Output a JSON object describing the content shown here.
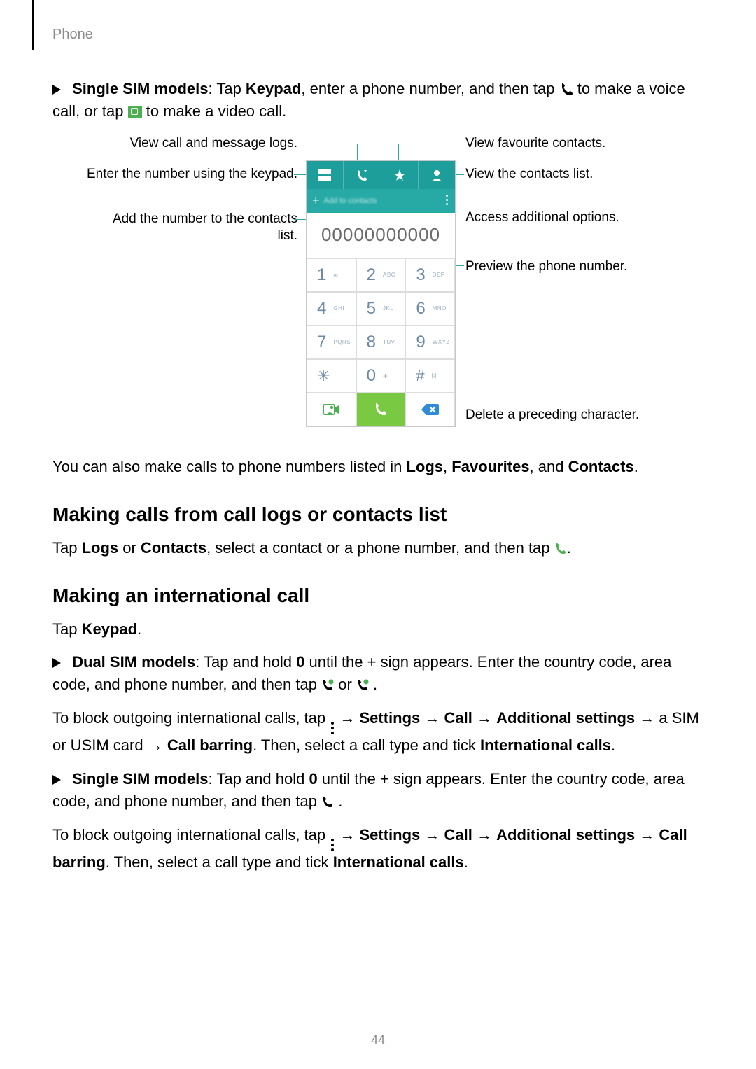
{
  "header": {
    "section": "Phone"
  },
  "intro": {
    "singleSimLead": "Single SIM models",
    "singleSimText1": ": Tap ",
    "keypad": "Keypad",
    "singleSimText2": ", enter a phone number, and then tap ",
    "singleSimText3": " to make a voice call, or tap ",
    "singleSimText4": " to make a video call."
  },
  "callouts": {
    "logs": "View call and message logs.",
    "keypad": "Enter the number using the keypad.",
    "addContact": "Add the number to the contacts list.",
    "favs": "View favourite contacts.",
    "contacts": "View the contacts list.",
    "options": "Access additional options.",
    "preview": "Preview the phone number.",
    "delete": "Delete a preceding character."
  },
  "mock": {
    "addToContacts": "Add to contacts",
    "numberPreview": "00000000000",
    "keys": {
      "k1": "1",
      "s1": "",
      "k2": "2",
      "s2": "ABC",
      "k3": "3",
      "s3": "DEF",
      "k4": "4",
      "s4": "GHI",
      "k5": "5",
      "s5": "JKL",
      "k6": "6",
      "s6": "MNO",
      "k7": "7",
      "s7": "PQRS",
      "k8": "8",
      "s8": "TUV",
      "k9": "9",
      "s9": "WXYZ",
      "star": "✳",
      "k0": "0",
      "s0": "+",
      "hash": "#"
    }
  },
  "afterDiagram": {
    "text1": "You can also make calls to phone numbers listed in ",
    "logs": "Logs",
    "c1": ", ",
    "favs": "Favourites",
    "c2": ", and ",
    "contacts": "Contacts",
    "c3": "."
  },
  "sec1": {
    "title": "Making calls from call logs or contacts list",
    "t1": "Tap ",
    "logs": "Logs",
    "t2": " or ",
    "contacts": "Contacts",
    "t3": ", select a contact or a phone number, and then tap ",
    "t4": "."
  },
  "sec2": {
    "title": "Making an international call",
    "tapKeypad1": "Tap ",
    "keypad": "Keypad",
    "tapKeypad2": ".",
    "dualLead": "Dual SIM models",
    "dual1": ": Tap and hold ",
    "zero": "0",
    "dual2": " until the + sign appears. Enter the country code, area code, and phone number, and then tap ",
    "dual3": " or ",
    "dual4": ".",
    "block1a": "To block outgoing international calls, tap ",
    "arrow": " → ",
    "settings": "Settings",
    "call": "Call",
    "addl": "Additional settings",
    "block1b": " a SIM or USIM card ",
    "barring": "Call barring",
    "block1c": ". Then, select a call type and tick ",
    "intl": "International calls",
    "dot": ".",
    "singleLead": "Single SIM models",
    "single1": ": Tap and hold ",
    "single2": " until the + sign appears. Enter the country code, area code, and phone number, and then tap ",
    "single3": ".",
    "block2a": "To block outgoing international calls, tap ",
    "block2b": ". Then, select a call type and tick "
  },
  "icons": {
    "phone": "phone-icon",
    "videoBox": "video-call-icon",
    "phoneGreen": "phone-sim1-icon",
    "phoneGreen2": "phone-sim2-icon",
    "kebab": "more-options-icon"
  },
  "pageNumber": "44"
}
